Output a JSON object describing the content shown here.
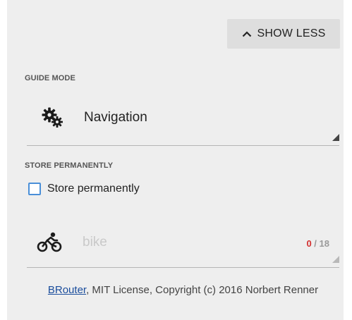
{
  "header": {
    "show_less_label": "SHOW LESS"
  },
  "guide_mode": {
    "section_label": "GUIDE MODE",
    "value": "Navigation",
    "icon": "gears-icon"
  },
  "store": {
    "section_label": "STORE PERMANENTLY",
    "checkbox_label": "Store permanently",
    "checked": false
  },
  "profile": {
    "placeholder": "bike",
    "icon": "bicycle-icon",
    "count_current": "0",
    "count_separator": " / ",
    "count_max": "18"
  },
  "credit": {
    "link_text": "BRouter",
    "text": ", MIT License, Copyright (c) 2016 Norbert Renner"
  },
  "colors": {
    "panel_bg": "#eeeeee",
    "button_bg": "#dedede",
    "checkbox_border": "#4a8fd8",
    "counter_red": "#d32f2f",
    "link_blue": "#1a4d9c"
  }
}
